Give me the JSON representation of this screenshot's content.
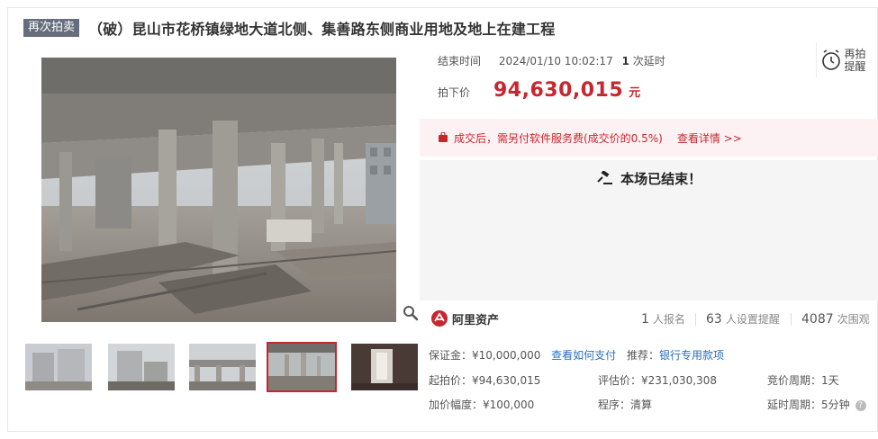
{
  "header": {
    "badge": "再次拍卖",
    "title": "（破）昆山市花桥镇绿地大道北侧、集善路东侧商业用地及地上在建工程"
  },
  "auction": {
    "end_label": "结束时间",
    "end_time": "2024/01/10 10:02:17",
    "delay_count": "1",
    "delay_label": "次延时",
    "price_label": "拍下价",
    "price": "94,630,015",
    "price_unit": "元",
    "remind_label": "再拍提醒",
    "fee_notice": "成交后，需另付软件服务费(成交价的0.5%)",
    "fee_more": "查看详情 >>",
    "ended_text": "本场已结束！"
  },
  "stats": {
    "logo_name": "阿里资产",
    "signups": "1",
    "signups_label": "人报名",
    "reminders": "63",
    "reminders_label": "人设置提醒",
    "views": "4087",
    "views_label": "次围观"
  },
  "details": {
    "deposit": "保证金：¥10,000,000",
    "deposit_link": "查看如何支付",
    "recommend_label": "推荐：",
    "recommend_link": "银行专用款项",
    "start_price": "起拍价：¥94,630,015",
    "assessed": "评估价：¥231,030,308",
    "bid_period": "竞价周期：1天",
    "increment": "加价幅度：¥100,000",
    "procedure": "程序：清算",
    "delay_period": "延时周期：5分钟"
  },
  "gallery": {
    "active_index": 3,
    "count": 5
  },
  "colors": {
    "accent": "#c8262f",
    "badge_bg": "#666d7c",
    "link": "#2a6ebb",
    "fee_bg": "#fdf2f3"
  },
  "icons": [
    "alarm-clock-icon",
    "magnifier-icon",
    "gavel-icon",
    "shopping-bag-icon",
    "ali-asset-logo-icon",
    "help-icon"
  ]
}
